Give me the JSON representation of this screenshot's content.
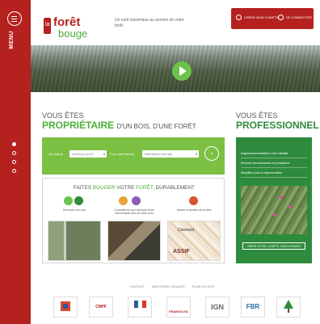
{
  "menu": {
    "label": "MENU",
    "slides": 4,
    "active_slide": 0
  },
  "header": {
    "logo_text_top": "forêt",
    "logo_text_bottom": "bouge",
    "logo_prefix": "la",
    "tagline": "Un outil numérique au service de votre forêt",
    "create_account": "CRÉER MON COMPTE",
    "login": "SE CONNECTER"
  },
  "owner": {
    "heading_small": "VOUS ÊTES",
    "heading_big": "PROPRIÉTAIRE",
    "heading_rest": "D'UN BOIS, D'UNE FORÊT",
    "search_label_1": "Où suis-je",
    "search_select_1": "Commune ou CP",
    "search_label_2": "Pour quel besoin",
    "search_select_2": "Sélectionnez une liste",
    "search_go": "›"
  },
  "features": {
    "title_a": "FAITES",
    "title_b": "BOUGER",
    "title_c": "VOTRE",
    "title_d": "FORÊT,",
    "title_e": "DURABLEMENT",
    "items": [
      {
        "text": "Découvrir vos bois"
      },
      {
        "text": "Consultez les prix des bois et les intervenants près de chez vous"
      },
      {
        "text": "Vendre et acheter de la forêt"
      }
    ],
    "map_label_1": "Clermont",
    "map_label_2": "ASSIF"
  },
  "pro": {
    "heading_small": "VOUS ÊTES",
    "heading_big": "PROFESSIONNEL",
    "rows": [
      "Augmentez/rentabilisez votre visibilité",
      "Recevez des demandes de prestations",
      "Simplifiez-vous la réglementation"
    ],
    "cta": "CRÉER VOTRE COMPTE GRATUITEMENT"
  },
  "footer": {
    "links": [
      "CONTACT",
      "MENTIONS LÉGALES",
      "PLAN DU SITE"
    ],
    "partners": [
      "",
      "CNPF",
      "",
      "FRANSYLVA",
      "IGN",
      "FBR",
      ""
    ]
  },
  "colors": {
    "brand_red": "#b5211f",
    "brand_green": "#4caf3a",
    "pro_green": "#2e8b3d",
    "search_green": "#7bc043"
  }
}
